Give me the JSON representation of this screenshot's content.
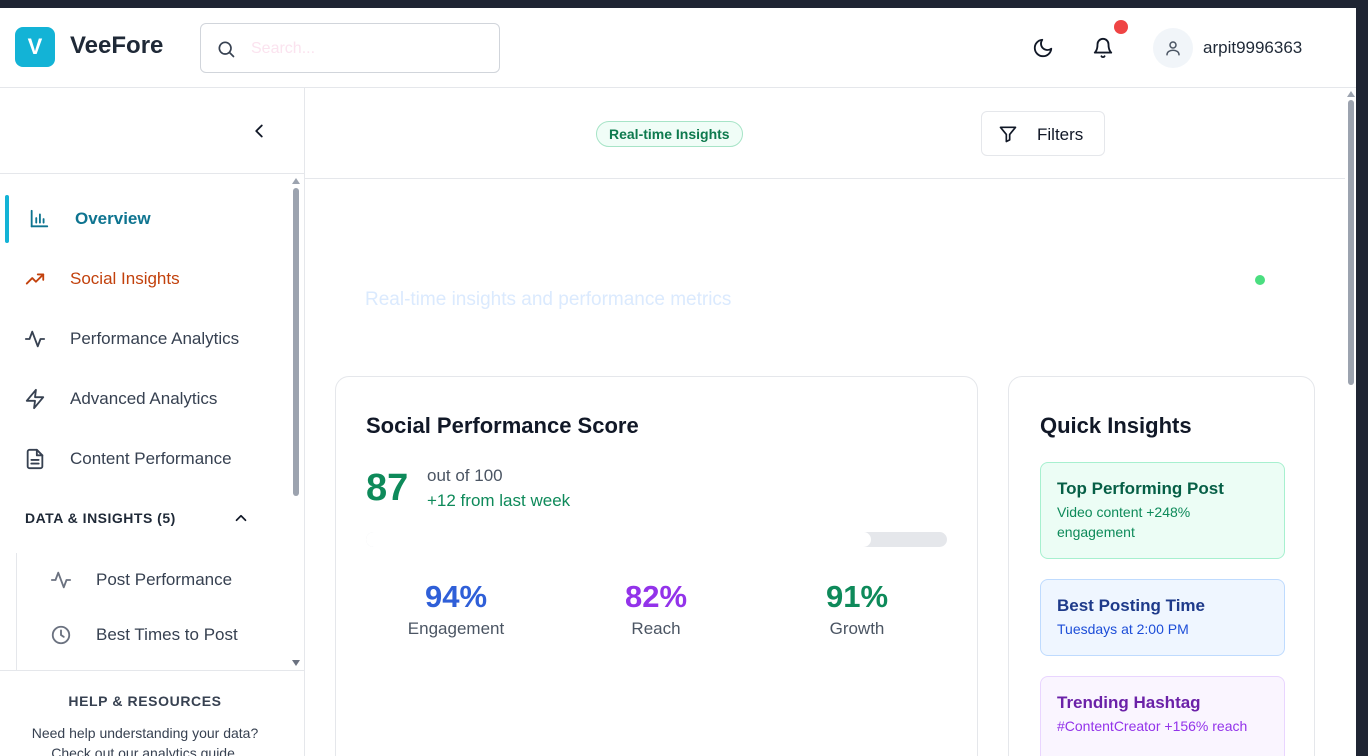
{
  "header": {
    "logo_letter": "V",
    "brand": "VeeFore",
    "search_placeholder": "Search...",
    "username": "arpit9996363",
    "icons": [
      "search-icon",
      "moon-icon",
      "bell-icon",
      "user-icon"
    ]
  },
  "sidebar": {
    "nav": [
      {
        "label": "Overview",
        "icon": "bar-chart-icon",
        "active": true,
        "color": "#0e7490"
      },
      {
        "label": "Social Insights",
        "icon": "trending-up-icon",
        "color": "#c2410c"
      },
      {
        "label": "Performance Analytics",
        "icon": "activity-icon",
        "color": "#374151"
      },
      {
        "label": "Advanced Analytics",
        "icon": "zap-icon",
        "color": "#374151"
      },
      {
        "label": "Content Performance",
        "icon": "file-text-icon",
        "color": "#374151"
      }
    ],
    "section": {
      "title": "DATA & INSIGHTS (5)",
      "items": [
        {
          "label": "Post Performance",
          "icon": "activity-icon"
        },
        {
          "label": "Best Times to Post",
          "icon": "clock-icon"
        }
      ]
    },
    "help": {
      "title": "HELP & RESOURCES",
      "line1": "Need help understanding your data?",
      "line2": "Check out our analytics guide."
    }
  },
  "main": {
    "badge": "Real-time Insights",
    "filters_label": "Filters",
    "subtitle": "Real-time insights and performance metrics",
    "score_card": {
      "title": "Social Performance Score",
      "score": "87",
      "out_of": "out of 100",
      "delta": "+12 from last week",
      "progress_fraction": 0.87,
      "metrics": [
        {
          "value": "94%",
          "label": "Engagement",
          "color": "#2f5fd8"
        },
        {
          "value": "82%",
          "label": "Reach",
          "color": "#9333ea"
        },
        {
          "value": "91%",
          "label": "Growth",
          "color": "#0e8a5a"
        }
      ]
    },
    "quick_insights": {
      "title": "Quick Insights",
      "items": [
        {
          "heading": "Top Performing Post",
          "text": "Video content +248% engagement",
          "bg": "#ecfdf5",
          "border": "#a7f0cf",
          "head_color": "#065f46",
          "text_color": "#0e8a5a"
        },
        {
          "heading": "Best Posting Time",
          "text": "Tuesdays at 2:00 PM",
          "bg": "#eff6ff",
          "border": "#bfdbfe",
          "head_color": "#1e3a8a",
          "text_color": "#1d4ed8"
        },
        {
          "heading": "Trending Hashtag",
          "text": "#ContentCreator +156% reach",
          "bg": "#faf5ff",
          "border": "#e9d5ff",
          "head_color": "#6b21a8",
          "text_color": "#9333ea"
        }
      ]
    }
  }
}
